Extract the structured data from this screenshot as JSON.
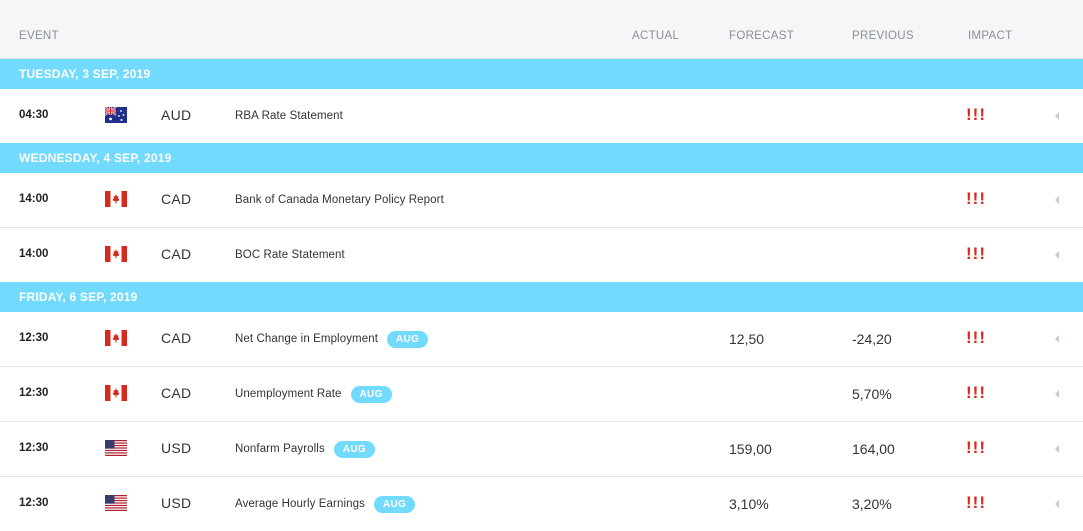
{
  "header": {
    "event": "EVENT",
    "actual": "ACTUAL",
    "forecast": "FORECAST",
    "previous": "PREVIOUS",
    "impact": "IMPACT"
  },
  "groups": [
    {
      "date": "TUESDAY, 3 SEP, 2019",
      "events": [
        {
          "time": "04:30",
          "flag": "australia-flag-icon",
          "currency": "AUD",
          "name": "RBA Rate Statement",
          "badge": "",
          "actual": "",
          "forecast": "",
          "previous": "",
          "impact": "!!!"
        }
      ]
    },
    {
      "date": "WEDNESDAY, 4 SEP, 2019",
      "events": [
        {
          "time": "14:00",
          "flag": "canada-flag-icon",
          "currency": "CAD",
          "name": "Bank of Canada Monetary Policy Report",
          "badge": "",
          "actual": "",
          "forecast": "",
          "previous": "",
          "impact": "!!!"
        },
        {
          "time": "14:00",
          "flag": "canada-flag-icon",
          "currency": "CAD",
          "name": "BOC Rate Statement",
          "badge": "",
          "actual": "",
          "forecast": "",
          "previous": "",
          "impact": "!!!"
        }
      ]
    },
    {
      "date": "FRIDAY, 6 SEP, 2019",
      "events": [
        {
          "time": "12:30",
          "flag": "canada-flag-icon",
          "currency": "CAD",
          "name": "Net Change in Employment",
          "badge": "AUG",
          "actual": "",
          "forecast": "12,50",
          "previous": "-24,20",
          "impact": "!!!"
        },
        {
          "time": "12:30",
          "flag": "canada-flag-icon",
          "currency": "CAD",
          "name": "Unemployment Rate",
          "badge": "AUG",
          "actual": "",
          "forecast": "",
          "previous": "5,70%",
          "impact": "!!!"
        },
        {
          "time": "12:30",
          "flag": "usa-flag-icon",
          "currency": "USD",
          "name": "Nonfarm Payrolls",
          "badge": "AUG",
          "actual": "",
          "forecast": "159,00",
          "previous": "164,00",
          "impact": "!!!"
        },
        {
          "time": "12:30",
          "flag": "usa-flag-icon",
          "currency": "USD",
          "name": "Average Hourly Earnings",
          "badge": "AUG",
          "actual": "",
          "forecast": "3,10%",
          "previous": "3,20%",
          "impact": "!!!"
        }
      ]
    }
  ],
  "colors": {
    "date_band": "#72dafc",
    "badge": "#72dafc",
    "impact_high": "#e0251b",
    "header_bg": "#f5f6f8"
  },
  "icons": {
    "expand": "chevron-left-icon"
  }
}
